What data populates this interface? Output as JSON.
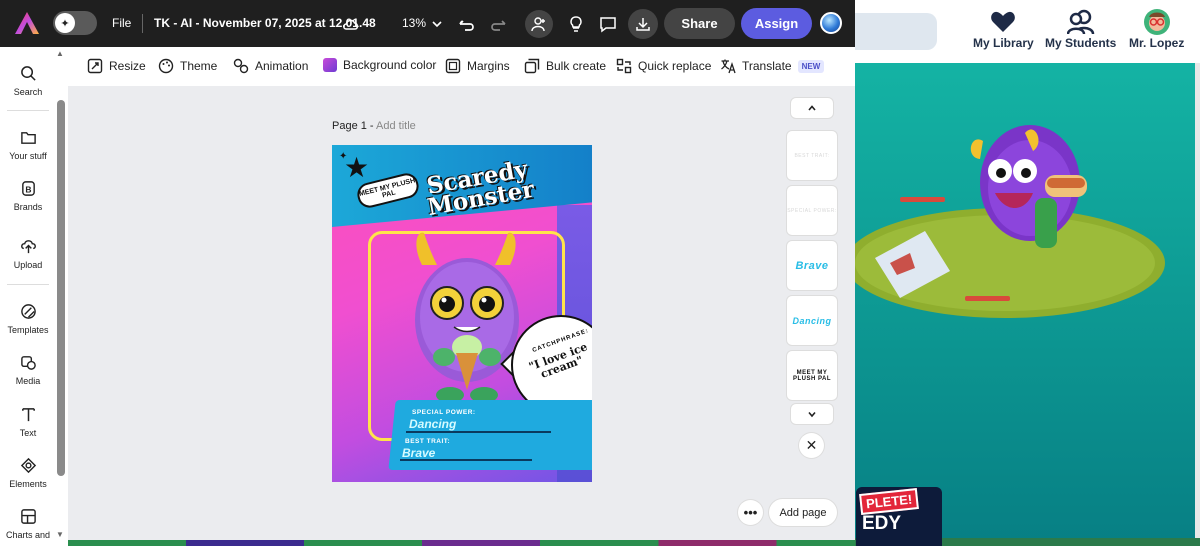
{
  "topbar": {
    "file_label": "File",
    "doc_title": "TK - AI - November 07, 2025 at 12.01.48",
    "zoom": "13%",
    "share_label": "Share",
    "assign_label": "Assign"
  },
  "rail": {
    "items": [
      {
        "label": "Search",
        "icon": "search-icon"
      },
      {
        "label": "Your stuff",
        "icon": "folder-icon"
      },
      {
        "label": "Brands",
        "icon": "brand-icon"
      },
      {
        "label": "Upload",
        "icon": "upload-icon"
      },
      {
        "label": "Templates",
        "icon": "templates-icon"
      },
      {
        "label": "Media",
        "icon": "media-icon"
      },
      {
        "label": "Text",
        "icon": "text-icon"
      },
      {
        "label": "Elements",
        "icon": "elements-icon"
      },
      {
        "label": "Charts and",
        "icon": "charts-icon"
      }
    ]
  },
  "toolbar2": {
    "items": [
      {
        "label": "Resize"
      },
      {
        "label": "Theme"
      },
      {
        "label": "Animation"
      },
      {
        "label": "Background color"
      },
      {
        "label": "Margins"
      },
      {
        "label": "Bulk create"
      },
      {
        "label": "Quick replace"
      },
      {
        "label": "Translate"
      }
    ],
    "new_badge": "NEW"
  },
  "page": {
    "label": "Page 1 -",
    "title_placeholder": "Add title"
  },
  "poster": {
    "badge": "MEET MY PLUSH PAL",
    "title": "Scaredy Monster",
    "catchphrase_label": "CATCHPHRASE:",
    "catchphrase": "\"I love ice cream\"",
    "special_power_label": "SPECIAL POWER:",
    "special_power": "Dancing",
    "best_trait_label": "BEST TRAIT:",
    "best_trait": "Brave"
  },
  "thumbnails": [
    {
      "text": "BEST TRAIT:"
    },
    {
      "text": "SPECIAL POWER:"
    },
    {
      "text": "Brave"
    },
    {
      "text": "Dancing"
    },
    {
      "text": "MEET MY PLUSH PAL"
    }
  ],
  "canvas_actions": {
    "add_page_label": "Add page"
  },
  "background_site": {
    "nav": [
      {
        "label": "My Library",
        "icon": "heart-icon"
      },
      {
        "label": "My Students",
        "icon": "students-icon"
      },
      {
        "label": "Mr. Lopez",
        "icon": "avatar-icon"
      }
    ],
    "card_tag": "PLETE!",
    "card_word": "EDY"
  }
}
